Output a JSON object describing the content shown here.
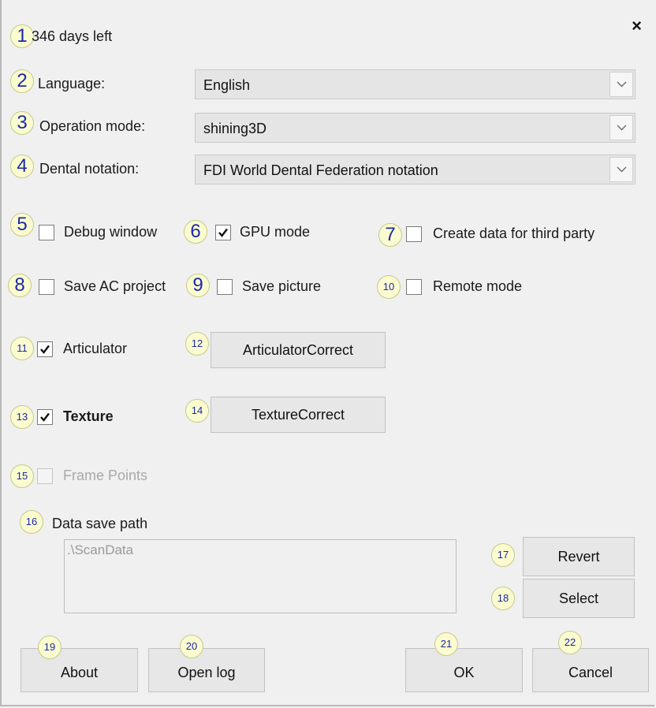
{
  "header": {
    "days_left": "346 days left",
    "close_glyph": "×"
  },
  "badges": [
    "1",
    "2",
    "3",
    "4",
    "5",
    "6",
    "7",
    "8",
    "9",
    "10",
    "11",
    "12",
    "13",
    "14",
    "15",
    "16",
    "17",
    "18",
    "19",
    "20",
    "21",
    "22"
  ],
  "language": {
    "label": "Language:",
    "value": "English"
  },
  "operation_mode": {
    "label": "Operation mode:",
    "value": "shining3D"
  },
  "dental_notation": {
    "label": "Dental notation:",
    "value": "FDI World Dental Federation notation"
  },
  "checkboxes": {
    "debug_window": {
      "label": "Debug window",
      "checked": false
    },
    "gpu_mode": {
      "label": "GPU mode",
      "checked": true
    },
    "third_party": {
      "label": "Create data for third party",
      "checked": false
    },
    "save_ac_project": {
      "label": "Save AC project",
      "checked": false
    },
    "save_picture": {
      "label": "Save picture",
      "checked": false
    },
    "remote_mode": {
      "label": "Remote mode",
      "checked": false
    },
    "articulator": {
      "label": "Articulator",
      "checked": true
    },
    "texture": {
      "label": "Texture",
      "checked": true
    },
    "frame_points": {
      "label": "Frame Points",
      "checked": false,
      "disabled": true
    }
  },
  "buttons": {
    "articulator_correct": "ArticulatorCorrect",
    "texture_correct": "TextureCorrect",
    "revert": "Revert",
    "select": "Select",
    "about": "About",
    "open_log": "Open log",
    "ok": "OK",
    "cancel": "Cancel"
  },
  "data_save": {
    "label": "Data save path",
    "path": ".\\ScanData"
  },
  "colors": {
    "badge_fill": "#fbfbd0",
    "badge_text": "#1b2aa6",
    "background": "#f0f0f0"
  }
}
